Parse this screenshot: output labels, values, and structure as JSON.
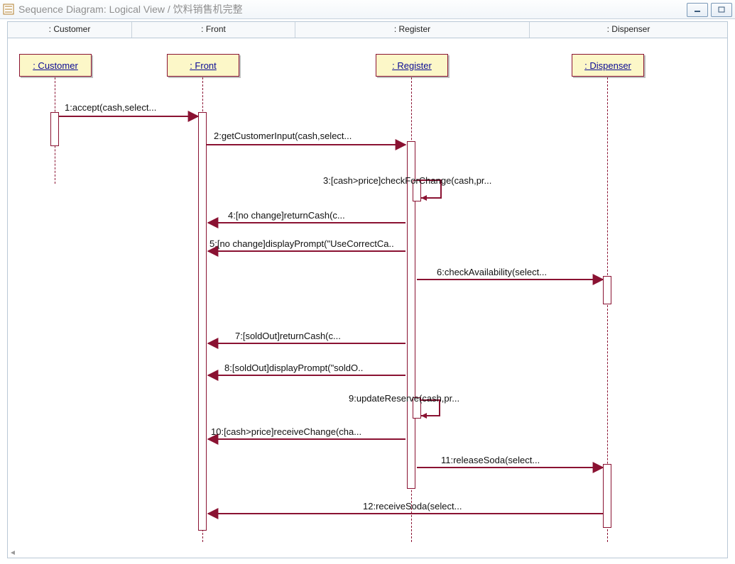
{
  "window": {
    "title": "Sequence Diagram: Logical View / 饮料销售机完整"
  },
  "columns": [
    ": Customer",
    ": Front",
    ": Register",
    ": Dispenser"
  ],
  "objects": [
    {
      "label": ": Customer"
    },
    {
      "label": ": Front"
    },
    {
      "label": ": Register"
    },
    {
      "label": ": Dispenser"
    }
  ],
  "messages": [
    "1:accept(cash,select...",
    "2:getCustomerInput(cash,select...",
    "3:[cash>price]checkForChange(cash,pr...",
    "4:[no change]returnCash(c...",
    "5:[no change]displayPrompt(\"UseCorrectCa..",
    "6:checkAvailability(select...",
    "7:[soldOut]returnCash(c...",
    "8:[soldOut]displayPrompt(\"soldO..",
    "9:updateReserve(cash,pr...",
    "10:[cash>price]receiveChange(cha...",
    "11:releaseSoda(select...",
    "12:receiveSoda(select..."
  ],
  "colors": {
    "maroon": "#8a1232",
    "yellow": "#fcf7c8",
    "linkblue": "#0a0a95"
  }
}
